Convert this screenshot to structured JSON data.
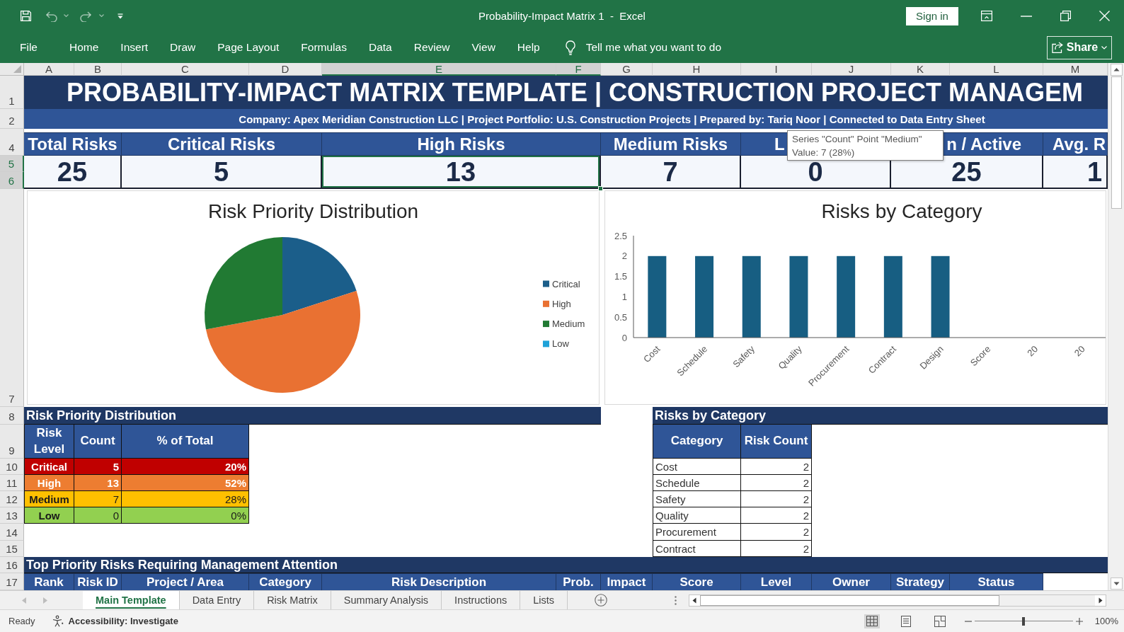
{
  "window": {
    "title": "Probability-Impact Matrix 1  -  Excel",
    "sign_in": "Sign in"
  },
  "menu": [
    "File",
    "Home",
    "Insert",
    "Draw",
    "Page Layout",
    "Formulas",
    "Data",
    "Review",
    "View",
    "Help"
  ],
  "tell_me": {
    "placeholder": "Tell me what you want to do"
  },
  "share": "Share",
  "column_headers": [
    {
      "label": "A",
      "selected": false
    },
    {
      "label": "B",
      "selected": false
    },
    {
      "label": "C",
      "selected": false
    },
    {
      "label": "D",
      "selected": false
    },
    {
      "label": "E",
      "selected": true
    },
    {
      "label": "F",
      "selected": true
    },
    {
      "label": "G",
      "selected": false
    },
    {
      "label": "H",
      "selected": false
    },
    {
      "label": "I",
      "selected": false
    },
    {
      "label": "J",
      "selected": false
    },
    {
      "label": "K",
      "selected": false
    },
    {
      "label": "L",
      "selected": false
    },
    {
      "label": "M",
      "selected": false
    }
  ],
  "row_headers": [
    {
      "label": "1",
      "selected": false
    },
    {
      "label": "2",
      "selected": false
    },
    {
      "label": "4",
      "selected": false
    },
    {
      "label": "5",
      "selected": true
    },
    {
      "label": "6",
      "selected": true
    },
    {
      "label": "7",
      "selected": false
    },
    {
      "label": "8",
      "selected": false
    },
    {
      "label": "9",
      "selected": false
    },
    {
      "label": "10",
      "selected": false
    },
    {
      "label": "11",
      "selected": false
    },
    {
      "label": "12",
      "selected": false
    },
    {
      "label": "13",
      "selected": false
    },
    {
      "label": "14",
      "selected": false
    },
    {
      "label": "15",
      "selected": false
    },
    {
      "label": "16",
      "selected": false
    },
    {
      "label": "17",
      "selected": false
    }
  ],
  "title": "PROBABILITY-IMPACT MATRIX TEMPLATE | CONSTRUCTION PROJECT MANAGEM",
  "subtitle": "Company: Apex Meridian Construction LLC | Project Portfolio: U.S. Construction Projects | Prepared by: Tariq Noor | Connected to Data Entry Sheet",
  "kpis": [
    {
      "label": "Total Risks",
      "value": "25",
      "selected": false
    },
    {
      "label": "Critical Risks",
      "value": "5",
      "selected": false
    },
    {
      "label": "High Risks",
      "value": "13",
      "selected": true
    },
    {
      "label": "Medium Risks",
      "value": "7",
      "selected": false
    },
    {
      "label": "L",
      "value": "0",
      "selected": false
    },
    {
      "label": "n / Active",
      "value": "25",
      "selected": false
    },
    {
      "label": "Avg. R",
      "value": "1",
      "selected": false
    }
  ],
  "tooltip": {
    "lines": [
      "Series \"Count\" Point \"Medium\"",
      "Value: 7 (28%)"
    ]
  },
  "pie_chart": {
    "chart_data": {
      "type": "pie",
      "title": "Risk Priority Distribution",
      "categories": [
        "Critical",
        "High",
        "Medium",
        "Low"
      ],
      "values": [
        20,
        52,
        28,
        0
      ],
      "colors": [
        "#1b5e8a",
        "#e97132",
        "#217a33",
        "#1fa2d8"
      ],
      "legend": "right"
    }
  },
  "bar_chart": {
    "chart_data": {
      "type": "bar",
      "title": "Risks by Category",
      "categories": [
        "Cost",
        "Schedule",
        "Safety",
        "Quality",
        "Procurement",
        "Contract",
        "Design",
        "Score",
        "20",
        "20"
      ],
      "values": [
        2,
        2,
        2,
        2,
        2,
        2,
        2,
        null,
        null,
        null
      ],
      "color": "#175e82",
      "ylim": [
        0,
        2.5
      ],
      "yticks": [
        0,
        0.5,
        1,
        1.5,
        2,
        2.5
      ]
    }
  },
  "priority_table": {
    "title": "Risk Priority Distribution",
    "columns": [
      "Risk Level",
      "Count",
      "% of Total"
    ],
    "rows": [
      {
        "level": "Critical",
        "count": "5",
        "percent": "20%",
        "color": "#c00000"
      },
      {
        "level": "High",
        "count": "13",
        "percent": "52%",
        "color": "#ed7d31"
      },
      {
        "level": "Medium",
        "count": "7",
        "percent": "28%",
        "color": "#ffc000"
      },
      {
        "level": "Low",
        "count": "0",
        "percent": "0%",
        "color": "#92d050"
      }
    ]
  },
  "category_table": {
    "title": "Risks by Category",
    "columns": [
      "Category",
      "Risk Count"
    ],
    "rows": [
      {
        "category": "Cost",
        "count": "2"
      },
      {
        "category": "Schedule",
        "count": "2"
      },
      {
        "category": "Safety",
        "count": "2"
      },
      {
        "category": "Quality",
        "count": "2"
      },
      {
        "category": "Procurement",
        "count": "2"
      },
      {
        "category": "Contract",
        "count": "2"
      }
    ]
  },
  "top_risks": {
    "title": "Top Priority Risks Requiring Management Attention",
    "columns": [
      "Rank",
      "Risk ID",
      "Project / Area",
      "Category",
      "Risk Description",
      "Prob.",
      "Impact",
      "Score",
      "Level",
      "Owner",
      "Strategy",
      "Status"
    ]
  },
  "sheet_tabs": [
    {
      "label": "Main Template",
      "selected": true
    },
    {
      "label": "Data Entry",
      "selected": false
    },
    {
      "label": "Risk Matrix",
      "selected": false
    },
    {
      "label": "Summary Analysis",
      "selected": false
    },
    {
      "label": "Instructions",
      "selected": false
    },
    {
      "label": "Lists",
      "selected": false
    }
  ],
  "status_bar": {
    "status": "Ready",
    "accessibility": "Accessibility: Investigate",
    "views": [
      {
        "kind": "normal",
        "selected": true
      },
      {
        "kind": "page_layout",
        "selected": false
      },
      {
        "kind": "page_break",
        "selected": false
      }
    ],
    "zoom": {
      "level": 0.5,
      "label": "100%"
    }
  }
}
